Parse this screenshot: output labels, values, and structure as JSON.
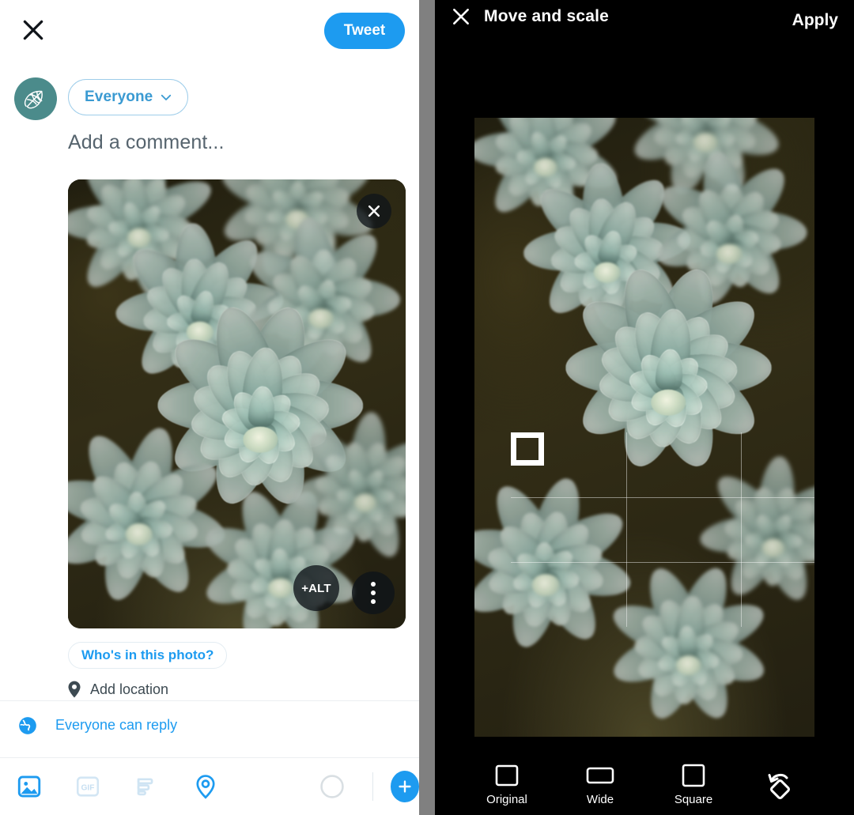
{
  "compose": {
    "close_icon": "close-icon",
    "tweet_button_label": "Tweet",
    "avatar_icon": "leaf-globe-avatar-icon",
    "audience": {
      "label": "Everyone",
      "chevron_icon": "chevron-down-icon"
    },
    "comment_placeholder": "Add a comment...",
    "photo": {
      "remove_icon": "close-icon",
      "alt_badge_label": "+ALT",
      "more_options_icon": "more-vertical-icon"
    },
    "tag_people_label": "Who's in this photo?",
    "add_location": {
      "icon": "location-pin-icon",
      "label": "Add location"
    },
    "reply_scope": {
      "icon": "globe-icon",
      "label": "Everyone can reply"
    },
    "toolbar": [
      {
        "name": "media-icon",
        "label": "Media",
        "state": "active"
      },
      {
        "name": "gif-icon",
        "label": "GIF",
        "state": "disabled"
      },
      {
        "name": "poll-icon",
        "label": "Poll",
        "state": "disabled"
      },
      {
        "name": "location-icon",
        "label": "Location",
        "state": "active"
      },
      {
        "name": "character-count-icon",
        "label": "Character count",
        "state": "idle"
      }
    ],
    "add_tweet_label": "+"
  },
  "crop": {
    "close_icon": "close-icon",
    "title": "Move and scale",
    "apply_label": "Apply",
    "ratios": [
      {
        "label": "Original",
        "icon": "rect-original-icon"
      },
      {
        "label": "Wide",
        "icon": "rect-wide-icon"
      },
      {
        "label": "Square",
        "icon": "rect-square-icon"
      }
    ],
    "rotate_icon": "rotate-icon"
  },
  "colors": {
    "accent": "#1d9bf0",
    "audience_blue": "#3a9ad2",
    "avatar_teal": "#4b8b8b",
    "panel_black": "#000000",
    "divider_gray": "#808080",
    "placeholder_gray": "#56646e"
  }
}
